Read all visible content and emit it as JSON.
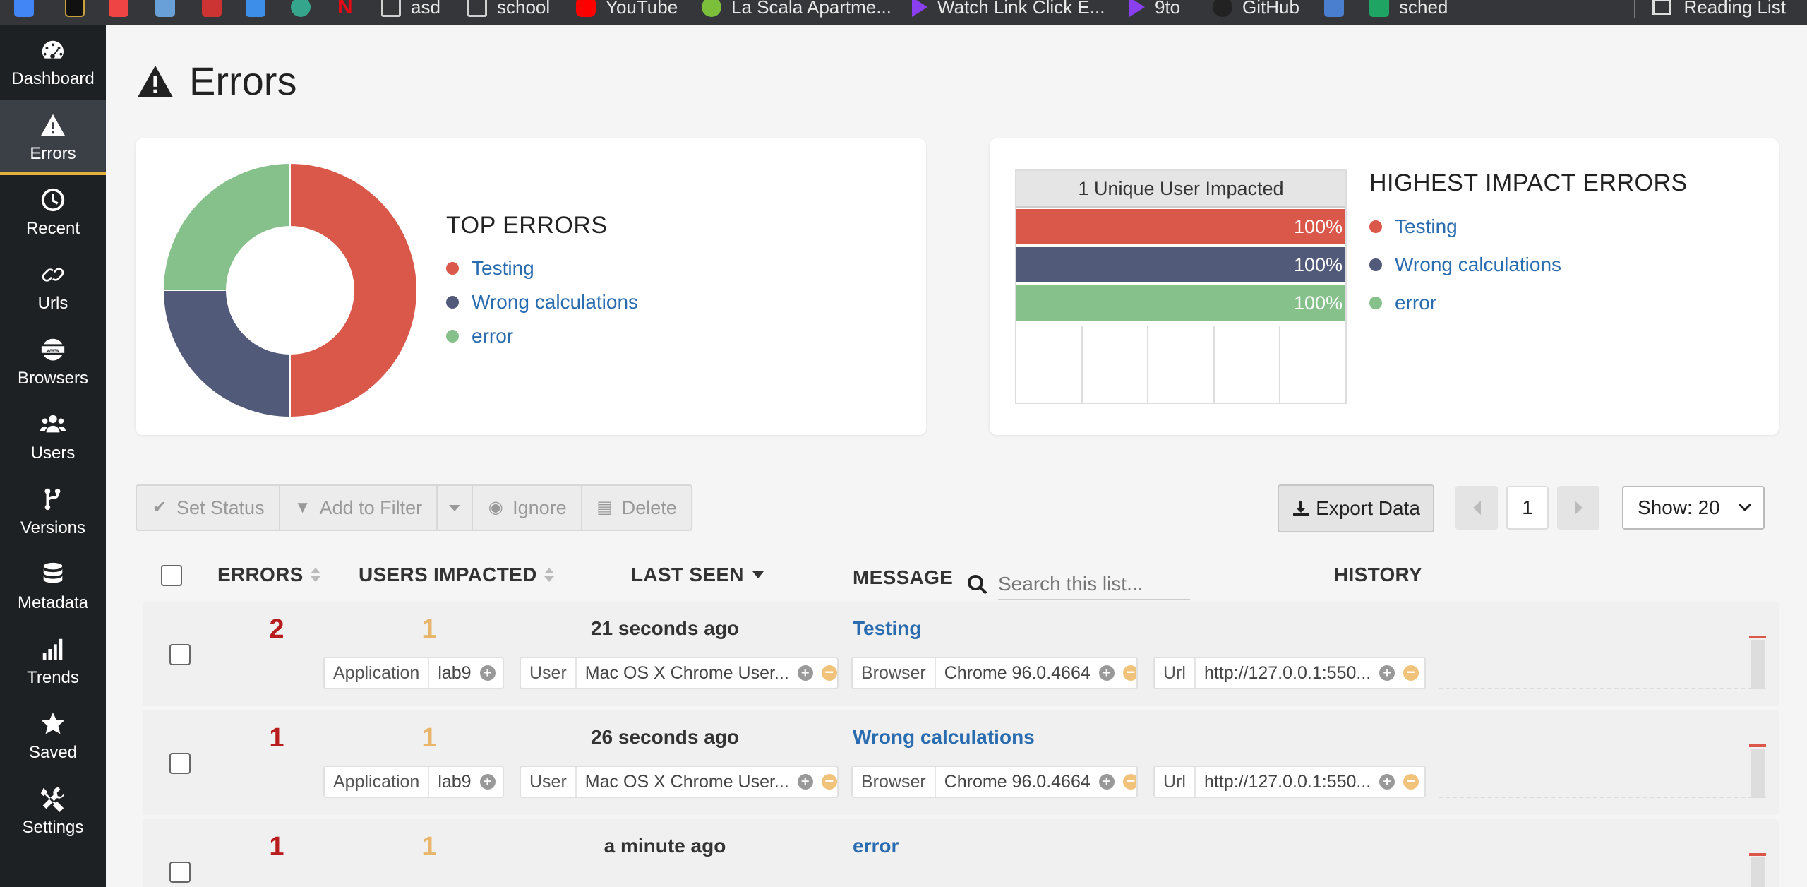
{
  "browser": {
    "bookmarks": [
      {
        "label": "asd"
      },
      {
        "label": "school"
      },
      {
        "label": "YouTube"
      },
      {
        "label": "La Scala Apartme..."
      },
      {
        "label": "Watch Link Click E..."
      },
      {
        "label": "9to"
      },
      {
        "label": "GitHub"
      },
      {
        "label": "sched"
      }
    ],
    "reading_list": "Reading List"
  },
  "sidebar": {
    "items": [
      {
        "label": "Dashboard",
        "icon": "gauge-icon"
      },
      {
        "label": "Errors",
        "icon": "warning-icon",
        "active": true
      },
      {
        "label": "Recent",
        "icon": "clock-icon"
      },
      {
        "label": "Urls",
        "icon": "link-icon"
      },
      {
        "label": "Browsers",
        "icon": "globe-www-icon"
      },
      {
        "label": "Users",
        "icon": "users-icon"
      },
      {
        "label": "Versions",
        "icon": "branch-icon"
      },
      {
        "label": "Metadata",
        "icon": "database-icon"
      },
      {
        "label": "Trends",
        "icon": "signal-bars-icon"
      },
      {
        "label": "Saved",
        "icon": "star-icon"
      },
      {
        "label": "Settings",
        "icon": "tools-icon"
      }
    ]
  },
  "page": {
    "title": "Errors"
  },
  "top_errors": {
    "title": "TOP ERRORS",
    "items": [
      {
        "label": "Testing",
        "color": "#d9584a"
      },
      {
        "label": "Wrong calculations",
        "color": "#525a7a"
      },
      {
        "label": "error",
        "color": "#86c08a"
      }
    ]
  },
  "chart_data": {
    "type": "pie",
    "categories": [
      "Testing",
      "Wrong calculations",
      "error"
    ],
    "values": [
      2,
      1,
      1
    ],
    "colors": [
      "#d9584a",
      "#525a7a",
      "#86c08a"
    ]
  },
  "highest_impact": {
    "title": "HIGHEST IMPACT ERRORS",
    "header": "1 Unique User Impacted",
    "bars": [
      {
        "percent_label": "100%",
        "color": "#d9584a"
      },
      {
        "percent_label": "100%",
        "color": "#525a7a"
      },
      {
        "percent_label": "100%",
        "color": "#86c08a"
      }
    ],
    "items": [
      {
        "label": "Testing",
        "color": "#d9584a"
      },
      {
        "label": "Wrong calculations",
        "color": "#525a7a"
      },
      {
        "label": "error",
        "color": "#86c08a"
      }
    ]
  },
  "toolbar": {
    "set_status": "Set Status",
    "add_to_filter": "Add to Filter",
    "ignore": "Ignore",
    "delete": "Delete",
    "export": "Export Data",
    "page": "1",
    "show": "Show: 20"
  },
  "table": {
    "headers": {
      "errors": "ERRORS",
      "users_impacted": "USERS IMPACTED",
      "last_seen": "LAST SEEN",
      "message": "MESSAGE",
      "history": "HISTORY"
    },
    "search_placeholder": "Search this list...",
    "rows": [
      {
        "errors": "2",
        "users": "1",
        "last_seen": "21 seconds ago",
        "message": "Testing",
        "tags": [
          {
            "key": "Application",
            "value": "lab9",
            "minus": false
          },
          {
            "key": "User",
            "value": "Mac OS X Chrome User...",
            "minus": true
          },
          {
            "key": "Browser",
            "value": "Chrome 96.0.4664",
            "minus": true
          },
          {
            "key": "Url",
            "value": "http://127.0.0.1:550...",
            "minus": true
          }
        ]
      },
      {
        "errors": "1",
        "users": "1",
        "last_seen": "26 seconds ago",
        "message": "Wrong calculations",
        "tags": [
          {
            "key": "Application",
            "value": "lab9",
            "minus": false
          },
          {
            "key": "User",
            "value": "Mac OS X Chrome User...",
            "minus": true
          },
          {
            "key": "Browser",
            "value": "Chrome 96.0.4664",
            "minus": true
          },
          {
            "key": "Url",
            "value": "http://127.0.0.1:550...",
            "minus": true
          }
        ]
      },
      {
        "errors": "1",
        "users": "1",
        "last_seen": "a minute ago",
        "message": "error",
        "tags": []
      }
    ]
  }
}
